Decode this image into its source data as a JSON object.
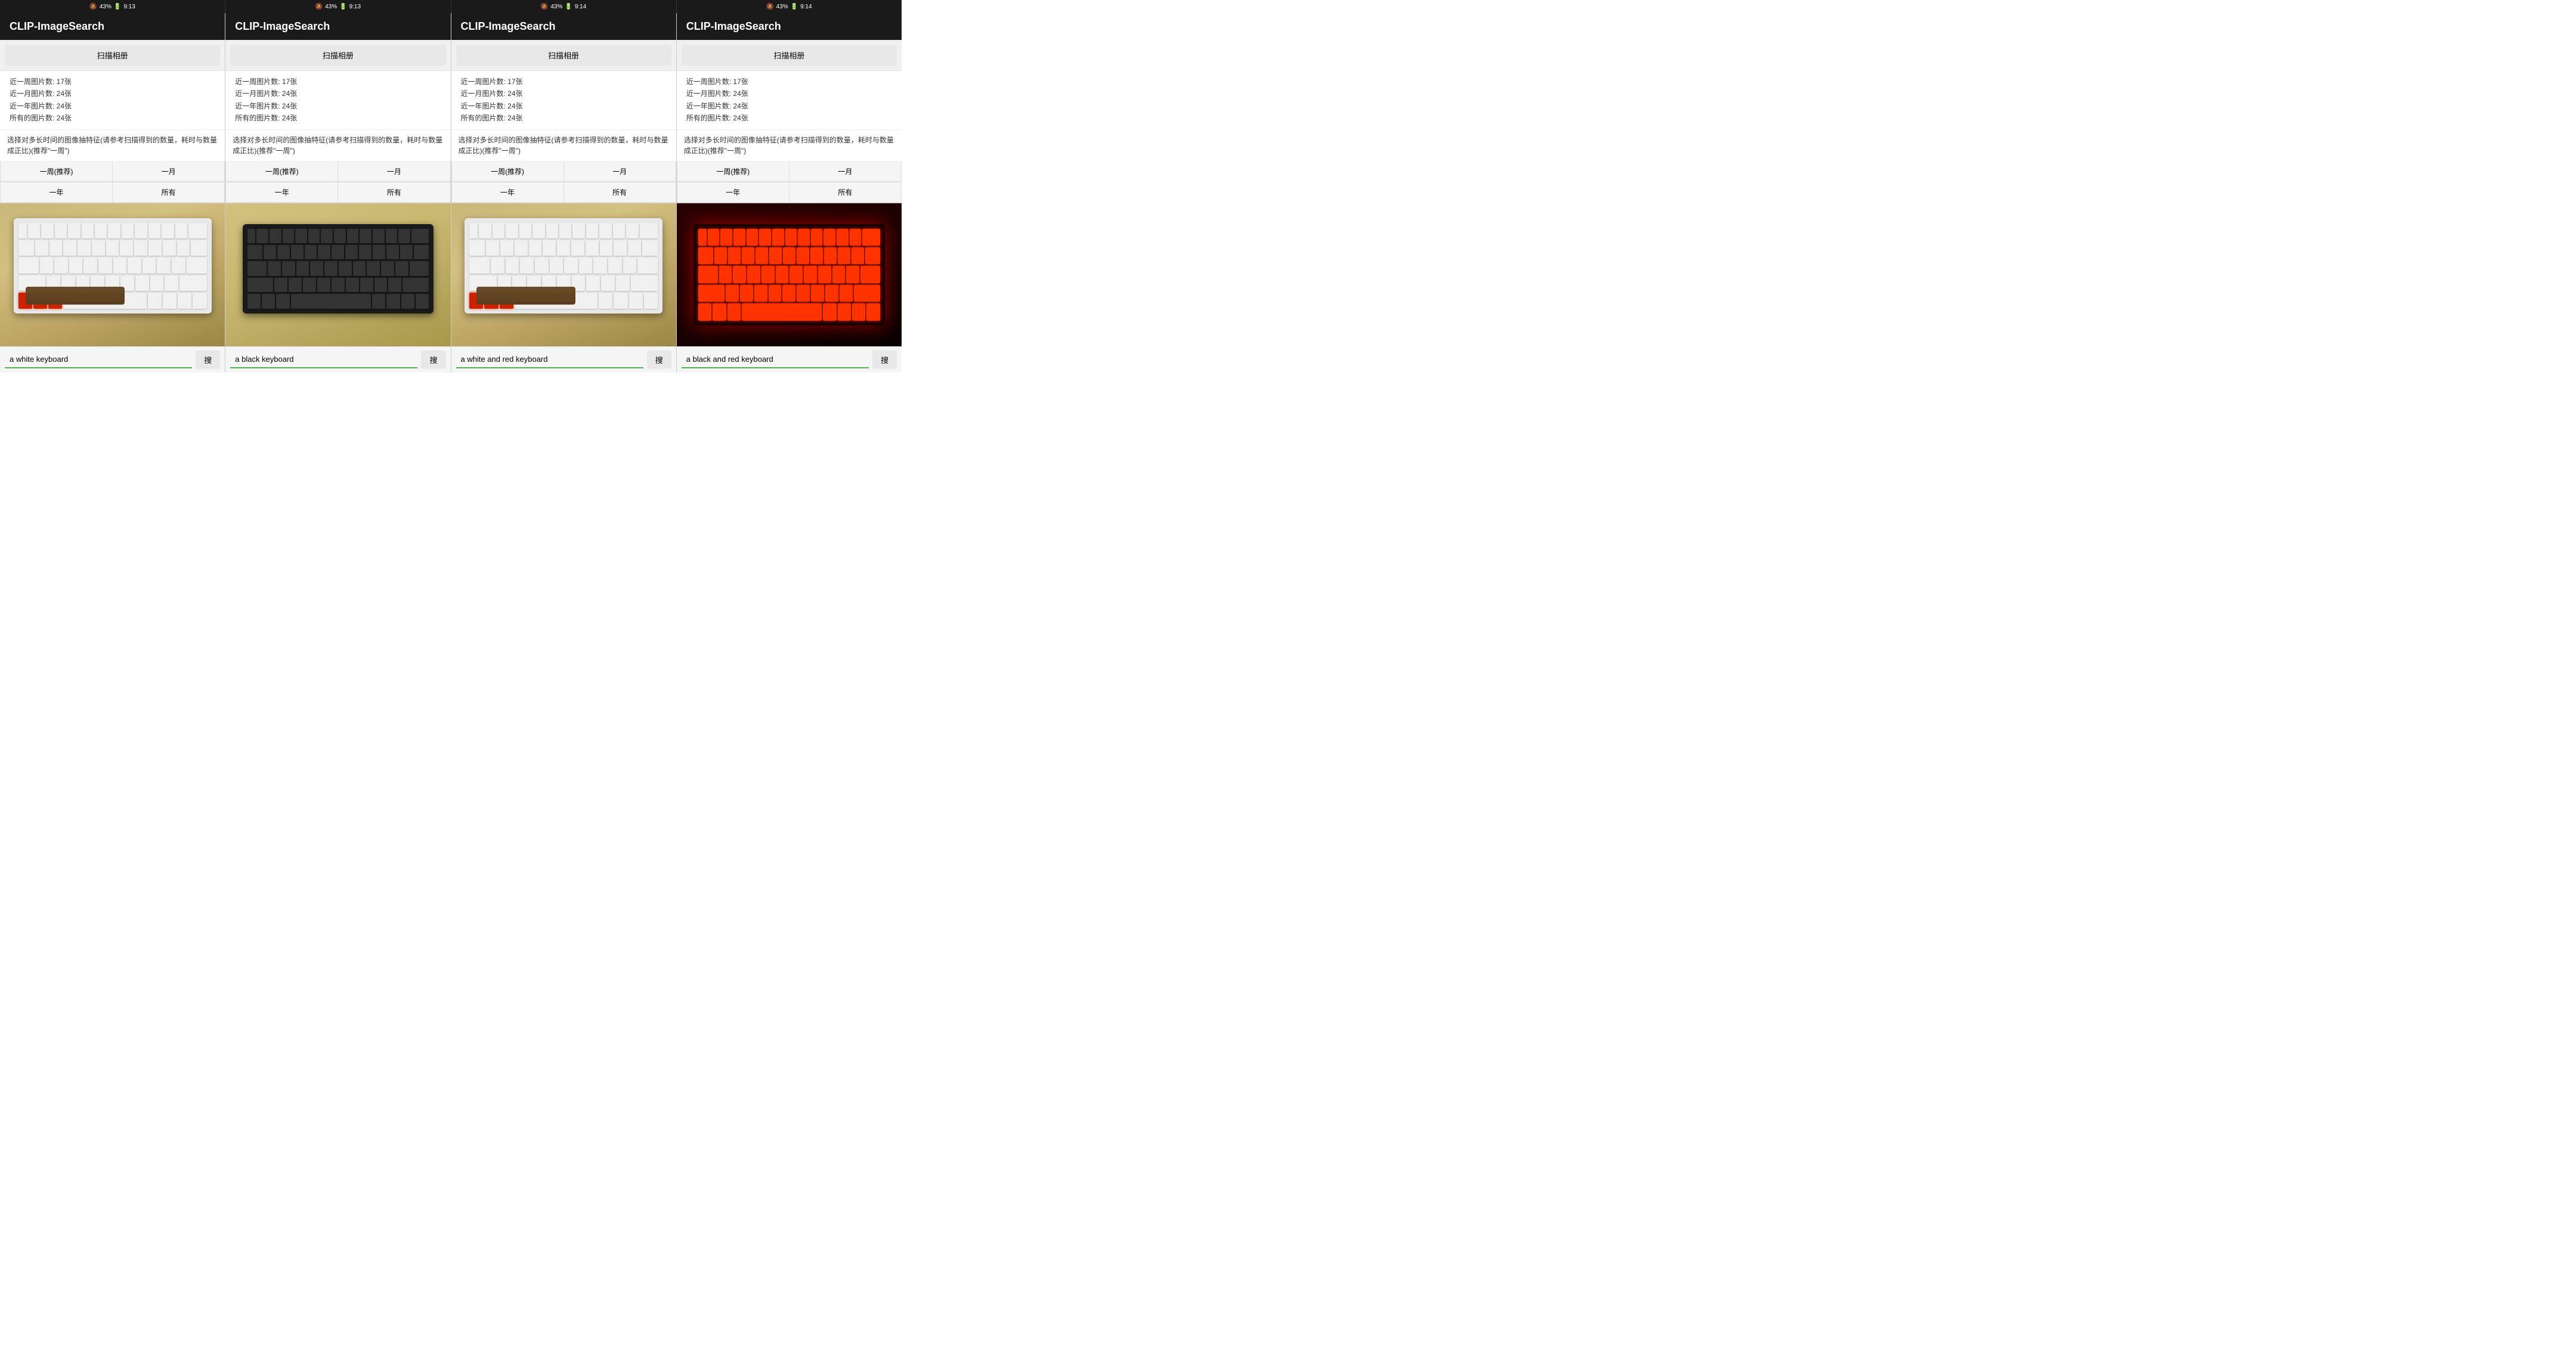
{
  "statusBar": {
    "segments": [
      {
        "battery": "43%",
        "time": "9:13"
      },
      {
        "battery": "43%",
        "time": "9:13"
      },
      {
        "battery": "43%",
        "time": "9:14"
      },
      {
        "battery": "43%",
        "time": "9:14"
      }
    ]
  },
  "panels": [
    {
      "id": "panel1",
      "appTitle": "CLIP-ImageSearch",
      "scanBtn": "扫描相册",
      "stats": [
        "近一周图片数: 17张",
        "近一月图片数: 24张",
        "近一年图片数: 24张",
        "所有的图片数: 24张"
      ],
      "desc": "选择对多长时间的图像抽特征(请参考扫描得到的数量，耗时与数量成正比)(推荐\"一周\")",
      "timeBtns": [
        "一周(推荐)",
        "一月",
        "一年",
        "所有"
      ],
      "searchValue": "a white keyboard",
      "searchBtn": "搜",
      "imageType": "white-red"
    },
    {
      "id": "panel2",
      "appTitle": "CLIP-ImageSearch",
      "scanBtn": "扫描相册",
      "stats": [
        "近一周图片数: 17张",
        "近一月图片数: 24张",
        "近一年图片数: 24张",
        "所有的图片数: 24张"
      ],
      "desc": "选择对多长时间的图像抽特征(请参考扫描得到的数量，耗时与数量成正比)(推荐\"一周\")",
      "timeBtns": [
        "一周(推荐)",
        "一月",
        "一年",
        "所有"
      ],
      "searchValue": "a black keyboard",
      "searchBtn": "搜",
      "imageType": "black"
    },
    {
      "id": "panel3",
      "appTitle": "CLIP-ImageSearch",
      "scanBtn": "扫描相册",
      "stats": [
        "近一周图片数: 17张",
        "近一月图片数: 24张",
        "近一年图片数: 24张",
        "所有的图片数: 24张"
      ],
      "desc": "选择对多长时间的图像抽特征(请参考扫描得到的数量，耗时与数量成正比)(推荐\"一周\")",
      "timeBtns": [
        "一周(推荐)",
        "一月",
        "一年",
        "所有"
      ],
      "searchValue": "a white and red keyboard",
      "searchBtn": "搜",
      "imageType": "white-red"
    },
    {
      "id": "panel4",
      "appTitle": "CLIP-ImageSearch",
      "scanBtn": "扫描相册",
      "stats": [
        "近一周图片数: 17张",
        "近一月图片数: 24张",
        "近一年图片数: 24张",
        "所有的图片数: 24张"
      ],
      "desc": "选择对多长时间的图像抽特征(请参考扫描得到的数量，耗时与数量成正比)(推荐\"一周\")",
      "timeBtns": [
        "一周(推荐)",
        "一月",
        "一年",
        "所有"
      ],
      "searchValue": "a black and red keyboard",
      "searchBtn": "搜",
      "imageType": "red-backlit"
    }
  ]
}
